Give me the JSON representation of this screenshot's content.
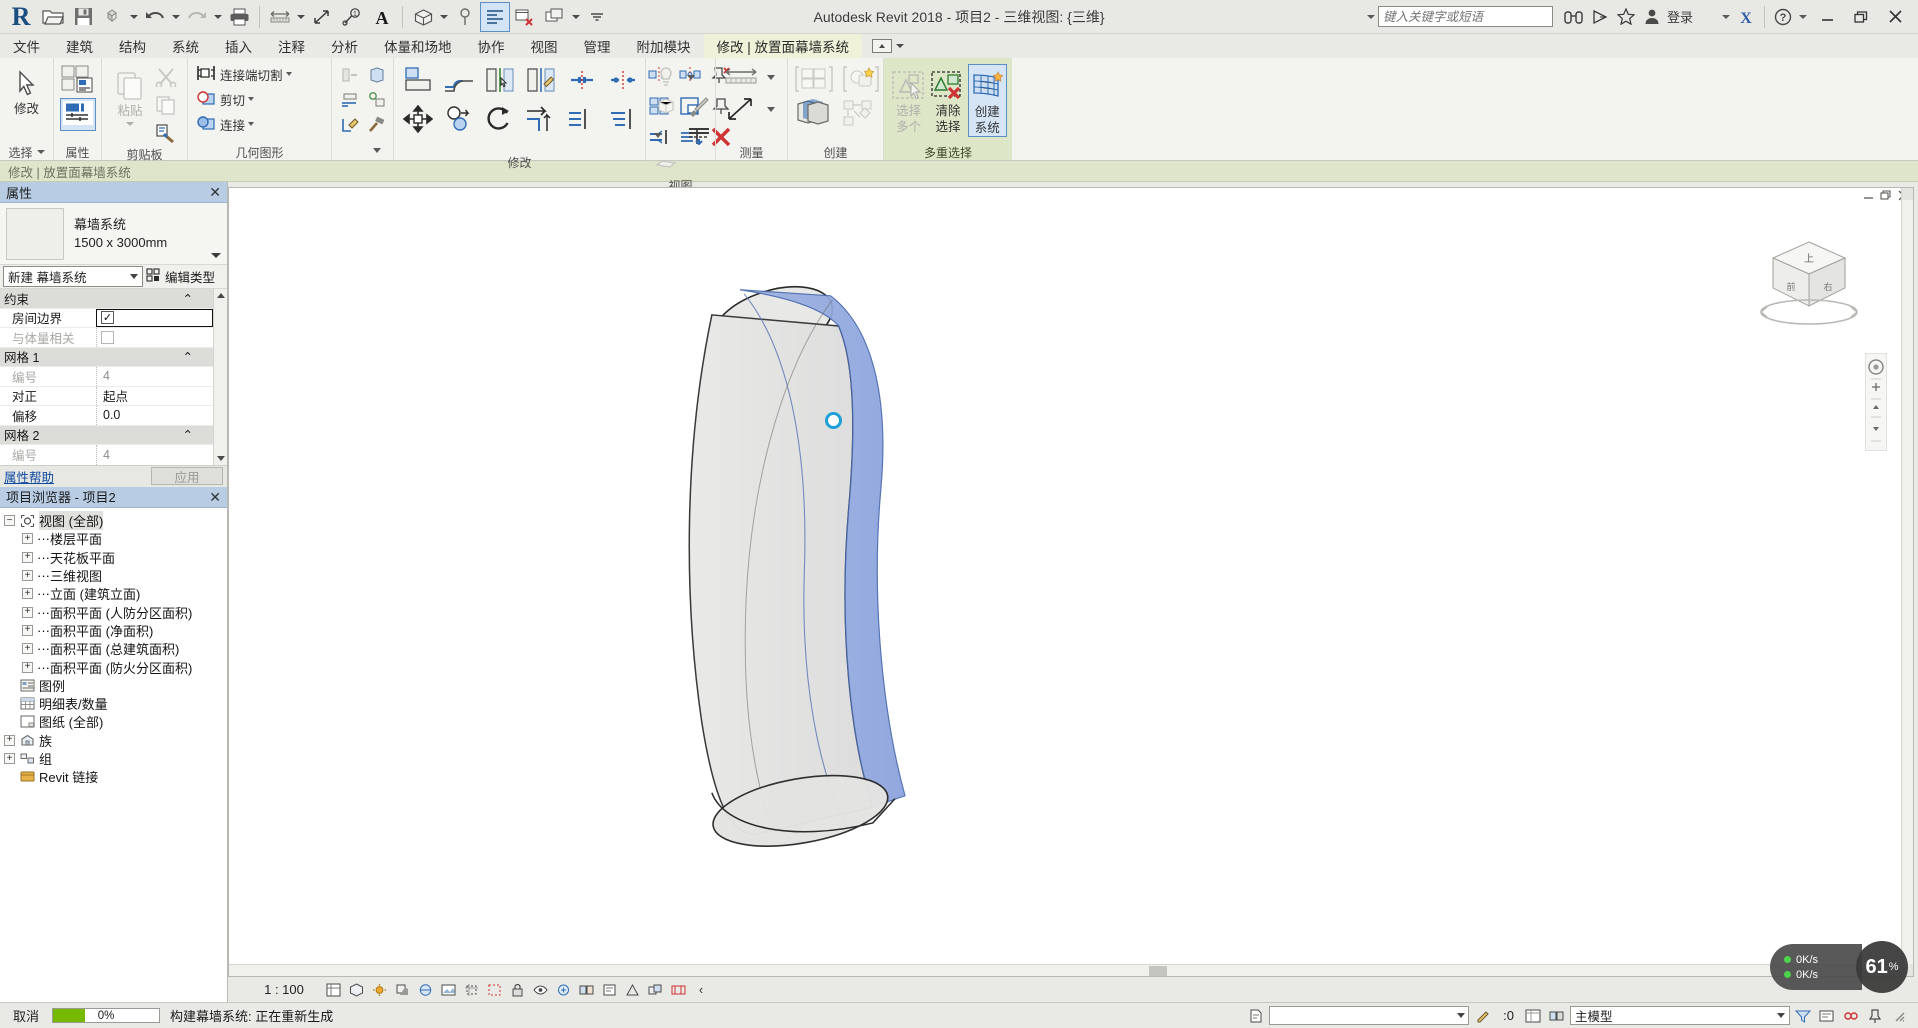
{
  "titlebar": {
    "app_title": "Autodesk Revit 2018 -    项目2 - 三维视图: {三维}",
    "search_placeholder": "键入关键字或短语",
    "signin_label": "登录",
    "qat": [
      {
        "name": "revit-logo",
        "label": "R"
      },
      {
        "name": "open-icon",
        "label": "打开"
      },
      {
        "name": "save-icon",
        "label": "保存"
      },
      {
        "name": "sync-icon",
        "label": "与中心文件同步"
      },
      {
        "name": "undo-icon",
        "label": "放弃"
      },
      {
        "name": "redo-icon",
        "label": "重做"
      },
      {
        "name": "print-icon",
        "label": "打印"
      },
      {
        "name": "measure-icon",
        "label": "测量"
      },
      {
        "name": "aligned-dimension-icon",
        "label": "对齐尺寸标注"
      },
      {
        "name": "tag-icon",
        "label": "按类别标记"
      },
      {
        "name": "text-icon",
        "label": "文字"
      },
      {
        "name": "default-3d-view-icon",
        "label": "默认三维视图"
      },
      {
        "name": "section-icon",
        "label": "剖面"
      },
      {
        "name": "thin-lines-icon",
        "label": "细线"
      },
      {
        "name": "close-hidden-windows-icon",
        "label": "关闭隐藏窗口"
      },
      {
        "name": "switch-windows-icon",
        "label": "切换窗口"
      },
      {
        "name": "customize-qat-icon",
        "label": "自定义快速访问工具栏"
      }
    ]
  },
  "tabs": [
    {
      "label": "文件",
      "active": false
    },
    {
      "label": "建筑",
      "active": false
    },
    {
      "label": "结构",
      "active": false
    },
    {
      "label": "系统",
      "active": false
    },
    {
      "label": "插入",
      "active": false
    },
    {
      "label": "注释",
      "active": false
    },
    {
      "label": "分析",
      "active": false
    },
    {
      "label": "体量和场地",
      "active": false
    },
    {
      "label": "协作",
      "active": false
    },
    {
      "label": "视图",
      "active": false
    },
    {
      "label": "管理",
      "active": false
    },
    {
      "label": "附加模块",
      "active": false
    },
    {
      "label": "修改 | 放置面幕墙系统",
      "active": true
    }
  ],
  "ribbon": {
    "panels": [
      {
        "title": "选择",
        "has_dropdown": true,
        "buttons": [
          {
            "label": "修改",
            "icon": "arrow-cursor-icon"
          }
        ]
      },
      {
        "title": "属性",
        "has_dropdown": false,
        "buttons": [
          {
            "label": "",
            "icon": "type-properties-icon"
          },
          {
            "label": "",
            "icon": "properties-panel-icon",
            "selected": true
          }
        ]
      },
      {
        "title": "剪贴板",
        "has_dropdown": false,
        "buttons": [
          {
            "label": "粘贴",
            "icon": "paste-icon",
            "disabled": true
          },
          {
            "label": "",
            "icon": "cut-icon",
            "disabled": true
          },
          {
            "label": "",
            "icon": "copy-icon",
            "disabled": true
          },
          {
            "label": "",
            "icon": "match-type-icon"
          }
        ]
      },
      {
        "title": "几何图形",
        "has_dropdown": false,
        "items": [
          {
            "label": "连接端切割",
            "icon": "cope-icon",
            "dropdown": true
          },
          {
            "label": "剪切",
            "icon": "cut-geometry-icon",
            "dropdown": true
          },
          {
            "label": "连接",
            "icon": "join-geometry-icon",
            "dropdown": true
          }
        ]
      },
      {
        "title": "修改",
        "has_dropdown": false,
        "icons": [
          "align-icon",
          "offset-icon",
          "mirror-pick-axis-icon",
          "mirror-draw-axis-icon",
          "split-element-icon",
          "split-with-gap-icon",
          "move-icon",
          "copy-icon",
          "rotate-icon",
          "trim-extend-icon",
          "array-icon",
          "scale-icon",
          "pin-icon",
          "unpin-icon",
          "delete-icon"
        ]
      },
      {
        "title": "视图",
        "has_dropdown": false,
        "icons": [
          "visibility-graphics-icon",
          "cutaway-icon",
          "paint-icon",
          "linework-icon"
        ]
      },
      {
        "title": "测量",
        "has_dropdown": false,
        "icons": [
          "measure-between-references-icon",
          "measure-along-element-icon"
        ]
      },
      {
        "title": "创建",
        "has_dropdown": false,
        "icons": [
          "create-similar-icon",
          "create-part-icon",
          "create-group-icon",
          "create-assembly-icon"
        ]
      },
      {
        "title": "多重选择",
        "highlight": true,
        "buttons": [
          {
            "label": "选择\n多个",
            "label_l1": "选择",
            "label_l2": "多个",
            "icon": "select-multiple-icon",
            "disabled": true
          },
          {
            "label_l1": "清除",
            "label_l2": "选择",
            "icon": "clear-selection-icon",
            "disabled": false
          },
          {
            "label_l1": "创建",
            "label_l2": "系统",
            "icon": "create-system-icon",
            "selected": true
          }
        ]
      }
    ]
  },
  "context_bar": {
    "text": "修改 | 放置面幕墙系统"
  },
  "properties": {
    "title": "属性",
    "type_name_line1": "幕墙系统",
    "type_name_line2": "1500 x 3000mm",
    "type_selector": "新建 幕墙系统",
    "edit_type_label": "编辑类型",
    "help_label": "属性帮助",
    "apply_label": "应用",
    "rows": [
      {
        "kind": "group",
        "label": "约束"
      },
      {
        "kind": "checkbox",
        "label": "房间边界",
        "checked": true,
        "disabled": false,
        "active": true
      },
      {
        "kind": "checkbox",
        "label": "与体量相关",
        "checked": false,
        "disabled": true
      },
      {
        "kind": "group",
        "label": "网格 1"
      },
      {
        "kind": "value",
        "label": "编号",
        "value": "4",
        "disabled": true
      },
      {
        "kind": "value",
        "label": "对正",
        "value": "起点"
      },
      {
        "kind": "value",
        "label": "偏移",
        "value": "0.0"
      },
      {
        "kind": "group",
        "label": "网格 2"
      },
      {
        "kind": "value",
        "label": "编号",
        "value": "4",
        "disabled": true
      }
    ]
  },
  "browser": {
    "title": "项目浏览器 - 项目2",
    "nodes": [
      {
        "label": "视图 (全部)",
        "level": 0,
        "expander": "-",
        "icon": "views-icon",
        "selected": true
      },
      {
        "label": "楼层平面",
        "level": 1,
        "expander": "+",
        "icon": "none"
      },
      {
        "label": "天花板平面",
        "level": 1,
        "expander": "+",
        "icon": "none"
      },
      {
        "label": "三维视图",
        "level": 1,
        "expander": "+",
        "icon": "none"
      },
      {
        "label": "立面 (建筑立面)",
        "level": 1,
        "expander": "+",
        "icon": "none"
      },
      {
        "label": "面积平面 (人防分区面积)",
        "level": 1,
        "expander": "+",
        "icon": "none"
      },
      {
        "label": "面积平面 (净面积)",
        "level": 1,
        "expander": "+",
        "icon": "none"
      },
      {
        "label": "面积平面 (总建筑面积)",
        "level": 1,
        "expander": "+",
        "icon": "none"
      },
      {
        "label": "面积平面 (防火分区面积)",
        "level": 1,
        "expander": "+",
        "icon": "none"
      },
      {
        "label": "图例",
        "level": 0,
        "expander": "",
        "icon": "legend-icon"
      },
      {
        "label": "明细表/数量",
        "level": 0,
        "expander": "",
        "icon": "schedule-icon"
      },
      {
        "label": "图纸 (全部)",
        "level": 0,
        "expander": "",
        "icon": "sheet-icon"
      },
      {
        "label": "族",
        "level": 0,
        "expander": "+",
        "icon": "family-icon"
      },
      {
        "label": "组",
        "level": 0,
        "expander": "+",
        "icon": "group-icon"
      },
      {
        "label": "Revit 链接",
        "level": 0,
        "expander": "",
        "icon": "revit-links-icon"
      }
    ]
  },
  "view": {
    "scale": "1 : 100",
    "viewcube_label_top": "上",
    "toolbar_icons": [
      "scale-icon",
      "detail-level-icon",
      "visual-style-icon",
      "sun-path-icon",
      "shadows-icon",
      "render-icon",
      "render-gallery-icon",
      "crop-view-icon",
      "show-crop-icon",
      "lock-3d-icon",
      "temporary-hide-icon",
      "reveal-hidden-icon",
      "worksharing-display-icon",
      "temporary-view-icon",
      "analytical-model-icon",
      "highlight-displacement-icon",
      "reveal-constraints-icon",
      "more-icon"
    ]
  },
  "statusbar": {
    "cancel_label": "取消",
    "progress_percent": 0,
    "progress_text": "0%",
    "message": "构建幕墙系统: 正在重新生成",
    "filter_placeholder": "",
    "selection_count": ":0",
    "model_label": "主模型",
    "right_icons": [
      "design-options-icon",
      "editable-only-icon",
      "exclude-options-icon",
      "filter-icon",
      "warnings-icon",
      "resize-grip-icon"
    ]
  },
  "network_widget": {
    "upload": "0K/s",
    "download": "0K/s",
    "battery": "61",
    "battery_unit": "%"
  },
  "colors": {
    "accent_blue": "#5c8fc4",
    "context_tab_bg": "#eff2d8",
    "panel_highlight": "#dde7c8",
    "palette_header": "#b8cce4",
    "progress_green": "#76b900",
    "selection_blue": "#1f9fd8",
    "curtain_fill": "#8ea8dc"
  }
}
